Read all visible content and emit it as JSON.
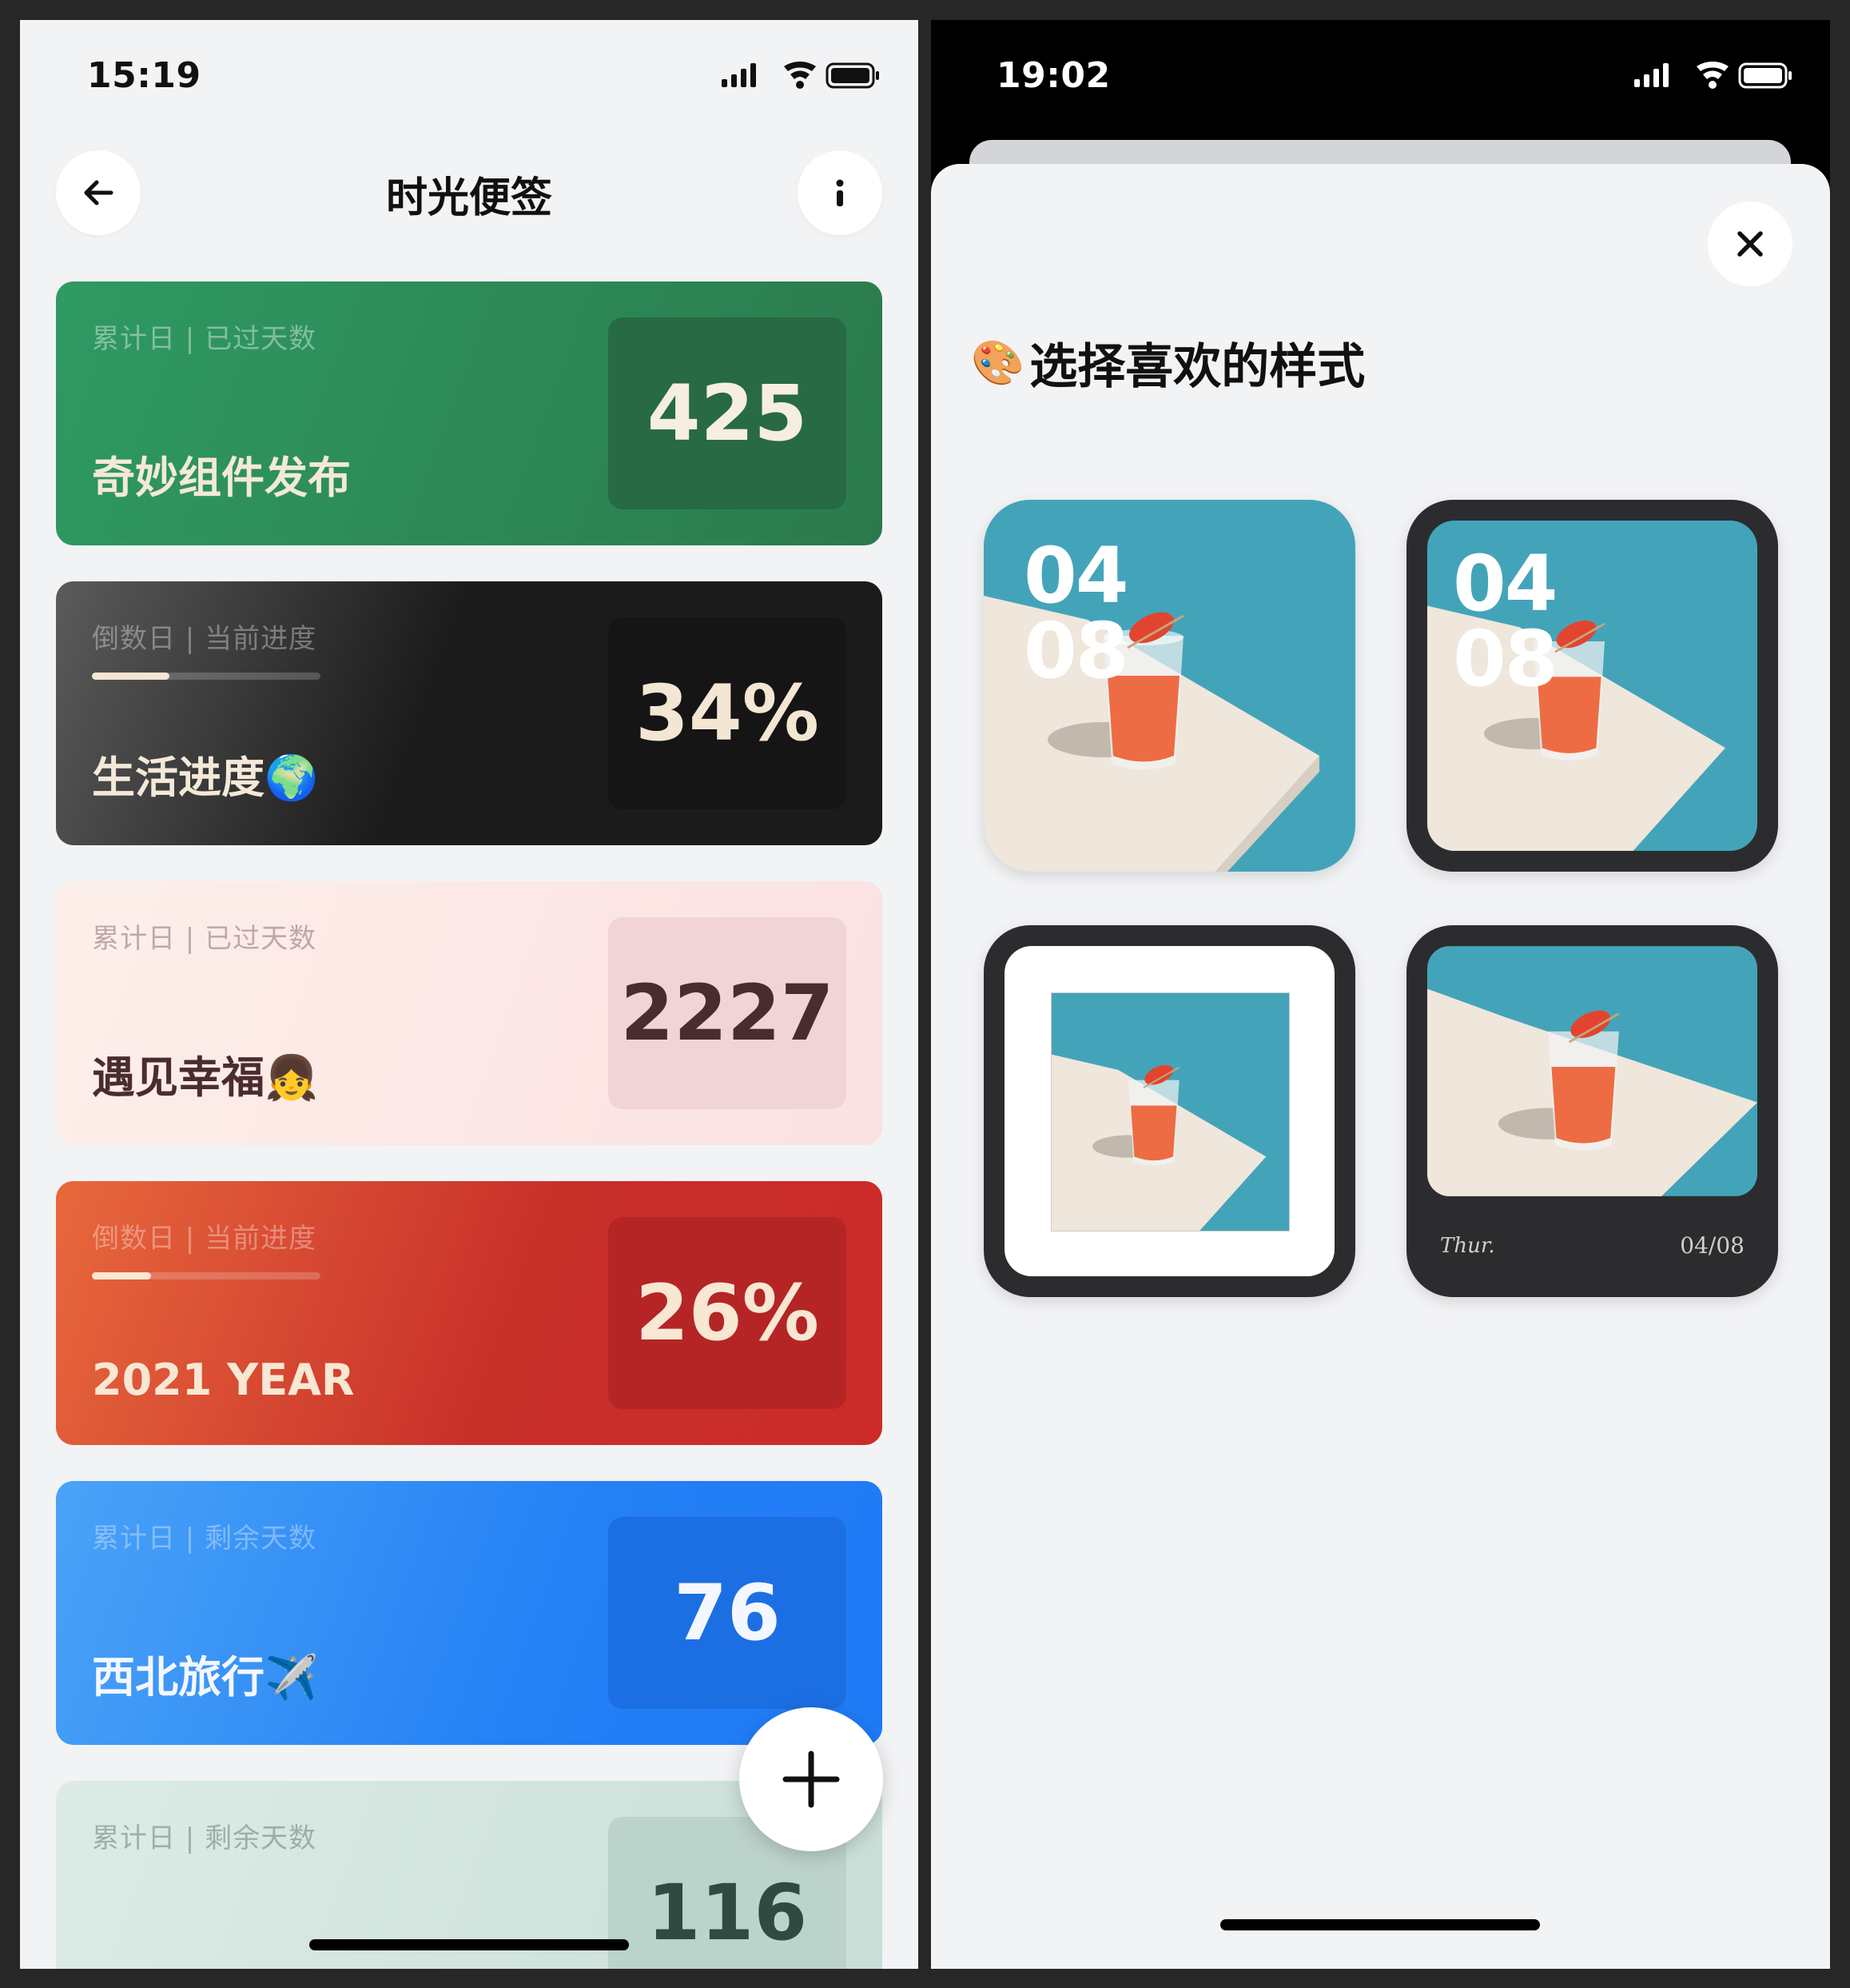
{
  "left_screen": {
    "status_time": "15:19",
    "title": "时光便签",
    "cards": [
      {
        "meta": "累计日 | 已过天数",
        "title": "奇妙组件发布",
        "emoji": "",
        "value": "425"
      },
      {
        "meta": "倒数日 | 当前进度",
        "title": "生活进度",
        "emoji": "🌍",
        "value": "34%",
        "progress": 0.34
      },
      {
        "meta": "累计日 | 已过天数",
        "title": "遇见幸福",
        "emoji": "👧",
        "value": "2227"
      },
      {
        "meta": "倒数日 | 当前进度",
        "title": "2021 YEAR",
        "emoji": "",
        "value": "26%",
        "progress": 0.26
      },
      {
        "meta": "累计日 | 剩余天数",
        "title": "西北旅行",
        "emoji": "✈️",
        "value": "76"
      },
      {
        "meta": "累计日 | 剩余天数",
        "title": "",
        "emoji": "",
        "value": "116"
      }
    ],
    "icons": {
      "back": "arrow-left-icon",
      "more": "more-vertical-icon",
      "add": "plus-icon"
    }
  },
  "right_screen": {
    "status_time": "19:02",
    "sheet_title": "选择喜欢的样式",
    "sheet_emoji": "🎨",
    "style_options": [
      {
        "style": "fullbleed",
        "num_top": "04",
        "num_bottom": "08"
      },
      {
        "style": "framed-dark",
        "num_top": "04",
        "num_bottom": "08"
      },
      {
        "style": "mat-white"
      },
      {
        "style": "polaroid-dark",
        "caption_left": "Thur.",
        "caption_right": "04/08"
      }
    ],
    "icons": {
      "close": "close-icon"
    }
  },
  "colors": {
    "green": "#2e8b57",
    "dark": "#1f1f1f",
    "pink": "#fbe3e3",
    "red": "#d8342b",
    "blue": "#2b86f5",
    "mint": "#cfe3dd",
    "photo_bg": "#3fa0b6"
  }
}
